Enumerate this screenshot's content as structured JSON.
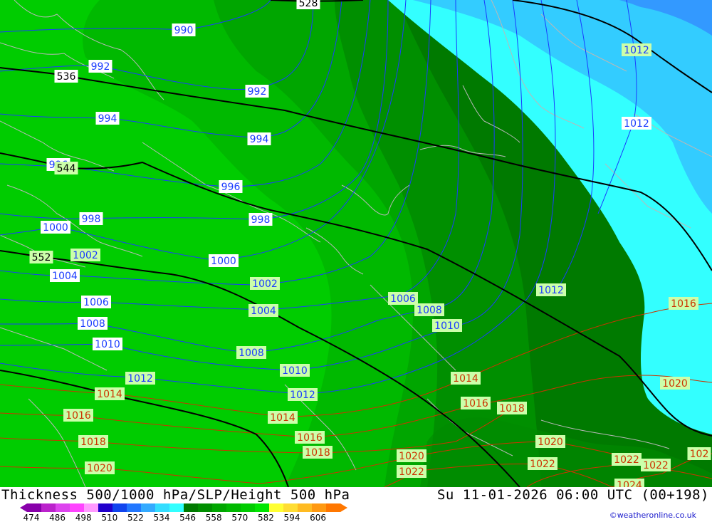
{
  "map": {
    "colors": {
      "bg": "#00cc00",
      "band_light": "#00b900",
      "band_mid": "#00a600",
      "band_dark": "#008f00",
      "band_darkest": "#007a00",
      "cyan": "#33ffff",
      "light_blue": "#33ccff",
      "blue": "#3399ff",
      "isobar_blue": "#1a3cff",
      "isobar_red": "#cc3300",
      "height_line": "#000000",
      "coast": "#b8b8b8",
      "label_bg_green": "#ccffaa",
      "label_bg_white": "#ffffff"
    },
    "slp_labels_blue": [
      {
        "id": "990",
        "text": "990"
      },
      {
        "id": "992a",
        "text": "992"
      },
      {
        "id": "992b",
        "text": "992"
      },
      {
        "id": "994a",
        "text": "994"
      },
      {
        "id": "994b",
        "text": "994"
      },
      {
        "id": "996a",
        "text": "996"
      },
      {
        "id": "996b",
        "text": "996"
      },
      {
        "id": "998a",
        "text": "998"
      },
      {
        "id": "998b",
        "text": "998"
      },
      {
        "id": "1000a",
        "text": "1000"
      },
      {
        "id": "1000b",
        "text": "1000"
      },
      {
        "id": "1002a",
        "text": "1002"
      },
      {
        "id": "1002b",
        "text": "1002"
      },
      {
        "id": "1004a",
        "text": "1004"
      },
      {
        "id": "1004b",
        "text": "1004"
      },
      {
        "id": "1006a",
        "text": "1006"
      },
      {
        "id": "1006b",
        "text": "1006"
      },
      {
        "id": "1008a",
        "text": "1008"
      },
      {
        "id": "1008b",
        "text": "1008"
      },
      {
        "id": "1008c",
        "text": "1008"
      },
      {
        "id": "1010a",
        "text": "1010"
      },
      {
        "id": "1010b",
        "text": "1010"
      },
      {
        "id": "1010c",
        "text": "1010"
      },
      {
        "id": "1012a",
        "text": "1012"
      },
      {
        "id": "1012b",
        "text": "1012"
      },
      {
        "id": "1012c",
        "text": "1012"
      },
      {
        "id": "1012d",
        "text": "1012"
      },
      {
        "id": "1012e",
        "text": "1012"
      }
    ],
    "slp_labels_red": [
      {
        "id": "1014a",
        "text": "1014"
      },
      {
        "id": "1014b",
        "text": "1014"
      },
      {
        "id": "1014c",
        "text": "1014"
      },
      {
        "id": "1016a",
        "text": "1016"
      },
      {
        "id": "1016b",
        "text": "1016"
      },
      {
        "id": "1016c",
        "text": "1016"
      },
      {
        "id": "1016d",
        "text": "1016"
      },
      {
        "id": "1018a",
        "text": "1018"
      },
      {
        "id": "1018b",
        "text": "1018"
      },
      {
        "id": "1018c",
        "text": "1018"
      },
      {
        "id": "1020a",
        "text": "1020"
      },
      {
        "id": "1020b",
        "text": "1020"
      },
      {
        "id": "1020c",
        "text": "1020"
      },
      {
        "id": "1020d",
        "text": "1020"
      },
      {
        "id": "1022a",
        "text": "1022"
      },
      {
        "id": "1022b",
        "text": "1022"
      },
      {
        "id": "1022c",
        "text": "1022"
      },
      {
        "id": "1022d",
        "text": "1022"
      },
      {
        "id": "1024",
        "text": "1024"
      },
      {
        "id": "102e",
        "text": "102"
      }
    ],
    "height_labels": [
      {
        "id": "528",
        "text": "528"
      },
      {
        "id": "536",
        "text": "536"
      },
      {
        "id": "544",
        "text": "544"
      },
      {
        "id": "552",
        "text": "552"
      }
    ]
  },
  "footer": {
    "title_left": "Thickness 500/1000 hPa/SLP/Height 500 hPa",
    "title_right": "Su 11-01-2026 06:00 UTC (00+198)",
    "credit": "©weatheronline.co.uk",
    "scale_ticks": [
      "474",
      "486",
      "498",
      "510",
      "522",
      "534",
      "546",
      "558",
      "570",
      "582",
      "594",
      "606"
    ],
    "scale_colors": [
      "#8800aa",
      "#bb22cc",
      "#dd44ee",
      "#ff44ff",
      "#ff99ff",
      "#2200cc",
      "#1144ee",
      "#2277ff",
      "#33aaff",
      "#33ddff",
      "#33ffff",
      "#007a00",
      "#008f00",
      "#00a600",
      "#00b900",
      "#00cc00",
      "#00e600",
      "#ffff33",
      "#ffdd33",
      "#ffbb22",
      "#ff9911",
      "#ff7700"
    ]
  }
}
